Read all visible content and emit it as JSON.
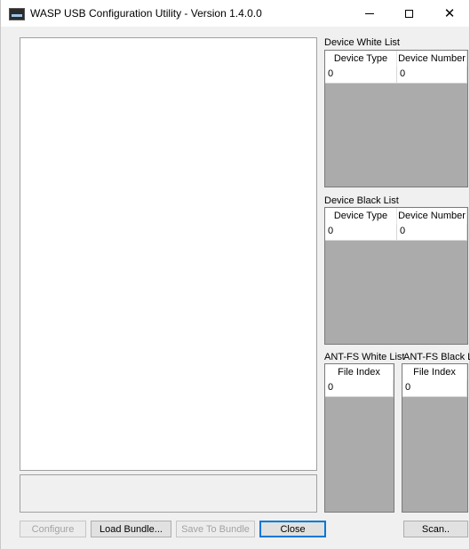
{
  "window": {
    "title": "WASP USB Configuration Utility - Version 1.4.0.0",
    "controls": {
      "minimize": "minimize",
      "maximize": "maximize",
      "close": "✕"
    }
  },
  "device_white_list": {
    "label": "Device White List",
    "columns": [
      "Device Type",
      "Device Number"
    ],
    "rows": [
      [
        "0",
        "0"
      ]
    ]
  },
  "device_black_list": {
    "label": "Device Black List",
    "columns": [
      "Device Type",
      "Device Number"
    ],
    "rows": [
      [
        "0",
        "0"
      ]
    ]
  },
  "antfs_white_list": {
    "label": "ANT-FS White List",
    "columns": [
      "File Index"
    ],
    "rows": [
      [
        "0"
      ]
    ]
  },
  "antfs_black_list": {
    "label": "ANT-FS Black List",
    "columns": [
      "File Index"
    ],
    "rows": [
      [
        "0"
      ]
    ]
  },
  "buttons": {
    "configure": "Configure",
    "load_bundle": "Load Bundle...",
    "save_to_bundle": "Save To Bundle",
    "close": "Close",
    "scan": "Scan.."
  },
  "colors": {
    "accent": "#0078d7",
    "grid_background": "#ababab",
    "window_background": "#f0f0f0"
  }
}
